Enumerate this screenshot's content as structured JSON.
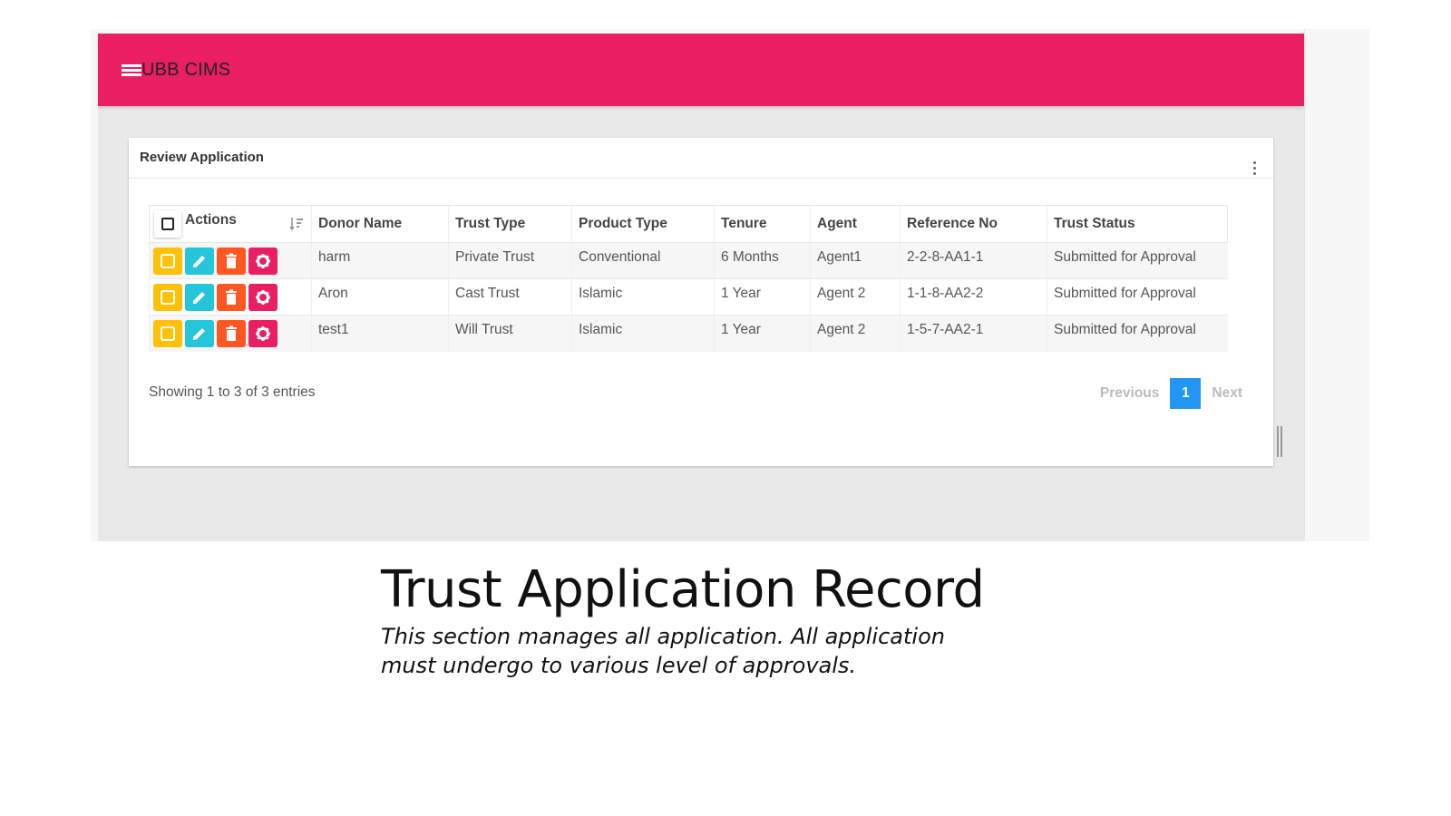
{
  "app": {
    "brand": "UBB CIMS"
  },
  "card": {
    "title": "Review Application"
  },
  "table": {
    "columns": [
      "Actions",
      "Donor Name",
      "Trust Type",
      "Product Type",
      "Tenure",
      "Agent",
      "Reference No",
      "Trust Status"
    ],
    "rows": [
      {
        "donor": "harm",
        "trust_type": "Private Trust",
        "product": "Conventional",
        "tenure": "6 Months",
        "agent": "Agent1",
        "ref": "2-2-8-AA1-1",
        "status": "Submitted for Approval"
      },
      {
        "donor": "Aron",
        "trust_type": "Cast Trust",
        "product": "Islamic",
        "tenure": "1 Year",
        "agent": "Agent 2",
        "ref": "1-1-8-AA2-2",
        "status": "Submitted for Approval"
      },
      {
        "donor": "test1",
        "trust_type": "Will Trust",
        "product": "Islamic",
        "tenure": "1 Year",
        "agent": "Agent 2",
        "ref": "1-5-7-AA2-1",
        "status": "Submitted for Approval"
      }
    ],
    "action_colors": {
      "view": "#ffc107",
      "edit": "#26c6da",
      "delete": "#ff5722",
      "settings": "#e91e63"
    }
  },
  "footer": {
    "info": "Showing 1 to 3 of 3 entries",
    "previous": "Previous",
    "current_page": "1",
    "next": "Next"
  },
  "slide": {
    "title": "Trust Application Record",
    "description": "This section manages all application. All application must undergo to various level of approvals."
  },
  "colors": {
    "topbar": "#e91e63",
    "pager_active": "#2196f3"
  }
}
